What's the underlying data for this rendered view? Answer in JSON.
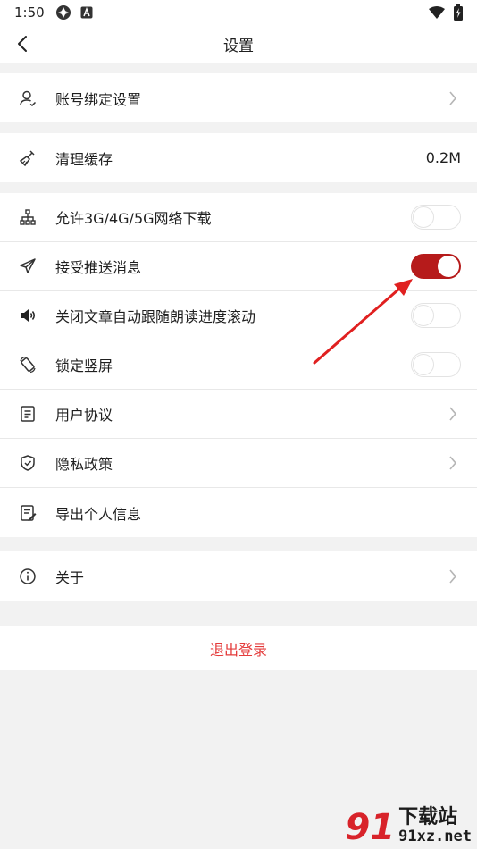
{
  "status_bar": {
    "time": "1:50",
    "icons_left": [
      "cloud-sync-icon",
      "app-a-icon"
    ],
    "icons_right": [
      "wifi-icon",
      "battery-charging-icon"
    ]
  },
  "title_bar": {
    "title": "设置",
    "back_icon": "back-arrow-icon"
  },
  "sections": {
    "account": {
      "items": [
        {
          "label": "账号绑定设置",
          "icon": "user-icon",
          "trailing": "chevron"
        }
      ]
    },
    "cache": {
      "items": [
        {
          "label": "清理缓存",
          "icon": "broom-icon",
          "value": "0.2M"
        }
      ]
    },
    "options": {
      "items": [
        {
          "label": "允许3G/4G/5G网络下载",
          "icon": "network-icon",
          "toggle": false
        },
        {
          "label": "接受推送消息",
          "icon": "send-icon",
          "toggle": true
        },
        {
          "label": "关闭文章自动跟随朗读进度滚动",
          "icon": "speaker-icon",
          "toggle": false
        },
        {
          "label": "锁定竖屏",
          "icon": "screen-rotation-icon",
          "toggle": false
        },
        {
          "label": "用户协议",
          "icon": "document-icon",
          "trailing": "chevron"
        },
        {
          "label": "隐私政策",
          "icon": "shield-icon",
          "trailing": "chevron"
        },
        {
          "label": "导出个人信息",
          "icon": "export-document-icon"
        }
      ]
    },
    "about": {
      "items": [
        {
          "label": "关于",
          "icon": "info-icon",
          "trailing": "chevron"
        }
      ]
    }
  },
  "logout": {
    "label": "退出登录"
  },
  "colors": {
    "accent_red": "#b61b1b",
    "logout_red": "#e43b3b",
    "page_background": "#f2f2f2",
    "annotation_arrow": "#e02020"
  },
  "watermark": {
    "mark": "91",
    "text": "下载站",
    "domain": "91xz.net"
  }
}
